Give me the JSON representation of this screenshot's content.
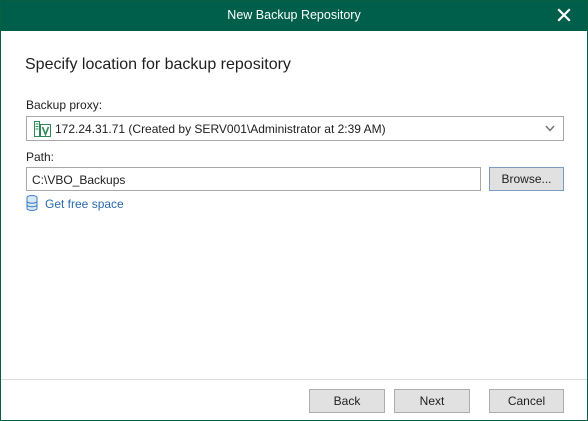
{
  "window": {
    "title": "New Backup Repository"
  },
  "page": {
    "heading": "Specify location for backup repository"
  },
  "proxy": {
    "label": "Backup proxy:",
    "selected": "172.24.31.71 (Created by SERV001\\Administrator at 2:39 AM)",
    "icon": "server-icon"
  },
  "path": {
    "label": "Path:",
    "value": "C:\\VBO_Backups",
    "browse_label": "Browse..."
  },
  "free_space": {
    "label": "Get free space",
    "icon": "database-icon"
  },
  "footer": {
    "back_label": "Back",
    "next_label": "Next",
    "cancel_label": "Cancel"
  },
  "colors": {
    "titlebar": "#005f4b",
    "link": "#2a6aad",
    "server_icon": "#2e8b57"
  }
}
